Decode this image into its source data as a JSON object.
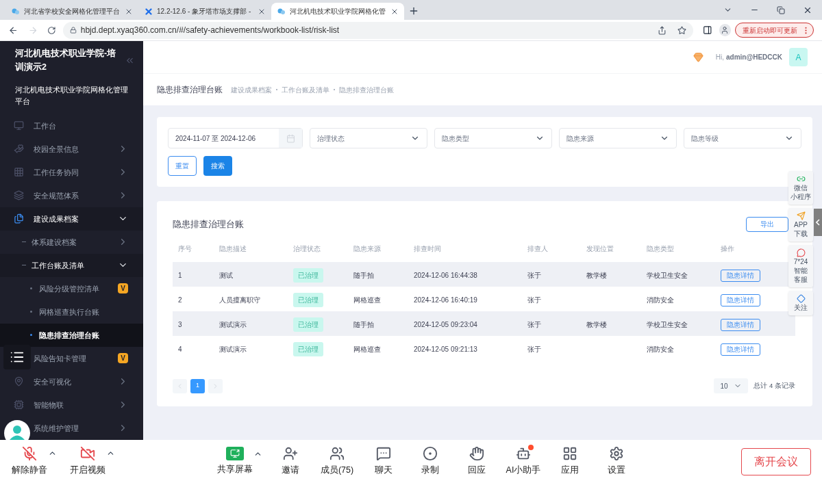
{
  "browser": {
    "tabs": [
      {
        "title": "河北省学校安全网格化管理平台",
        "selected": false,
        "kind": "cloud"
      },
      {
        "title": "12.2-12.6 - 象牙塔市场支撑部 -",
        "selected": false,
        "kind": "cross"
      },
      {
        "title": "河北机电技术职业学院网格化管",
        "selected": true,
        "kind": "cloud"
      }
    ],
    "url": "hbjd.dept.xyaq360.com.cn/#/safety-achievements/workbook-list/risk-list",
    "update_button": "重新启动即可更新"
  },
  "sidebar": {
    "title": "河北机电技术职业学院-培训演示2",
    "subtitle": "河北机电技术职业学院网格化管理平台",
    "items": [
      {
        "label": "工作台",
        "kind": "monitor",
        "expandable": false,
        "expanded": false,
        "selected": false
      },
      {
        "label": "校园全景信息",
        "kind": "hand",
        "expandable": true,
        "expanded": false,
        "selected": false
      },
      {
        "label": "工作任务协同",
        "kind": "grid",
        "expandable": true,
        "expanded": false,
        "selected": false
      },
      {
        "label": "安全规范体系",
        "kind": "layers",
        "expandable": true,
        "expanded": false,
        "selected": false
      },
      {
        "label": "建设成果档案",
        "kind": "files",
        "expandable": true,
        "expanded": true,
        "selected": false,
        "children": [
          {
            "label": "体系建设档案",
            "expandable": true,
            "expanded": false,
            "selected": false
          },
          {
            "label": "工作台账及清单",
            "expandable": true,
            "expanded": true,
            "selected": false,
            "children": [
              {
                "label": "风险分级管控清单",
                "badge": "V",
                "selected": false
              },
              {
                "label": "网格巡查执行台账",
                "selected": false
              },
              {
                "label": "隐患排查治理台账",
                "selected": true
              }
            ]
          }
        ]
      },
      {
        "label": "风险告知卡管理",
        "selected": false,
        "badge": "V"
      },
      {
        "label": "安全可视化",
        "kind": "map",
        "expandable": true,
        "expanded": false,
        "selected": false
      },
      {
        "label": "智能物联",
        "kind": "iot",
        "expandable": true,
        "expanded": false,
        "selected": false
      },
      {
        "label": "系统维护管理",
        "expandable": true,
        "expanded": false,
        "selected": false
      }
    ]
  },
  "header": {
    "greeting": "Hi,",
    "user": "admin@HEDCCK",
    "avatar": "A"
  },
  "breadcrumb": {
    "title": "隐患排查治理台账",
    "crumbs": [
      "建设成果档案",
      "工作台账及清单",
      "隐患排查治理台账"
    ]
  },
  "filters": {
    "date_range": "2024-11-07 至 2024-12-06",
    "selects": [
      "治理状态",
      "隐患类型",
      "隐患来源",
      "隐患等级"
    ],
    "reset": "重置",
    "search": "搜索"
  },
  "table": {
    "title": "隐患排查治理台账",
    "export": "导出",
    "columns": [
      "序号",
      "隐患描述",
      "治理状态",
      "隐患来源",
      "排查时间",
      "排查人",
      "发现位置",
      "隐患类型",
      "操作"
    ],
    "rows": [
      {
        "cells": [
          "1",
          "测试",
          "已治理",
          "随手拍",
          "2024-12-06 16:44:38",
          "张于",
          "教学楼",
          "学校卫生安全",
          "隐患详情"
        ]
      },
      {
        "cells": [
          "2",
          "人员擅离职守",
          "已治理",
          "网格巡查",
          "2024-12-06 16:40:19",
          "张于",
          "",
          "消防安全",
          "隐患详情"
        ]
      },
      {
        "cells": [
          "3",
          "测试演示",
          "已治理",
          "随手拍",
          "2024-12-05 09:23:04",
          "张于",
          "教学楼",
          "学校卫生安全",
          "隐患详情"
        ]
      },
      {
        "cells": [
          "4",
          "测试演示",
          "已治理",
          "网格巡查",
          "2024-12-05 09:21:13",
          "张于",
          "",
          "消防安全",
          "隐患详情"
        ]
      }
    ],
    "pages": [
      {
        "label": "1",
        "selected": true
      }
    ],
    "page_size": "10",
    "total": "总计 4 条记录"
  },
  "float_panel": [
    {
      "kind": "link",
      "lines": [
        "微信",
        "小程序"
      ]
    },
    {
      "kind": "send",
      "lines": [
        "APP",
        "下载"
      ]
    },
    {
      "kind": "chat",
      "lines": [
        "7*24",
        "智能",
        "客服"
      ]
    },
    {
      "kind": "diamond",
      "lines": [
        "关注"
      ]
    }
  ],
  "meeting": {
    "items": [
      {
        "label": "解除静音",
        "kind": "mic-off",
        "menu": true,
        "notification": false
      },
      {
        "label": "开启视频",
        "kind": "video-off",
        "menu": true,
        "notification": false
      },
      {
        "label": "共享屏幕",
        "kind": "share",
        "menu": true,
        "notification": false
      },
      {
        "label": "邀请",
        "kind": "invite",
        "menu": false,
        "notification": false
      },
      {
        "label": "成员(75)",
        "kind": "users",
        "menu": false,
        "notification": false
      },
      {
        "label": "聊天",
        "kind": "chat",
        "menu": false,
        "notification": false
      },
      {
        "label": "录制",
        "kind": "record",
        "menu": false,
        "notification": false
      },
      {
        "label": "回应",
        "kind": "hand",
        "menu": false,
        "notification": false
      },
      {
        "label": "AI小助手",
        "kind": "bot",
        "menu": false,
        "notification": true
      },
      {
        "label": "应用",
        "kind": "apps",
        "menu": false,
        "notification": false
      },
      {
        "label": "设置",
        "kind": "settings",
        "menu": false,
        "notification": false
      }
    ],
    "leave": "离开会议"
  }
}
